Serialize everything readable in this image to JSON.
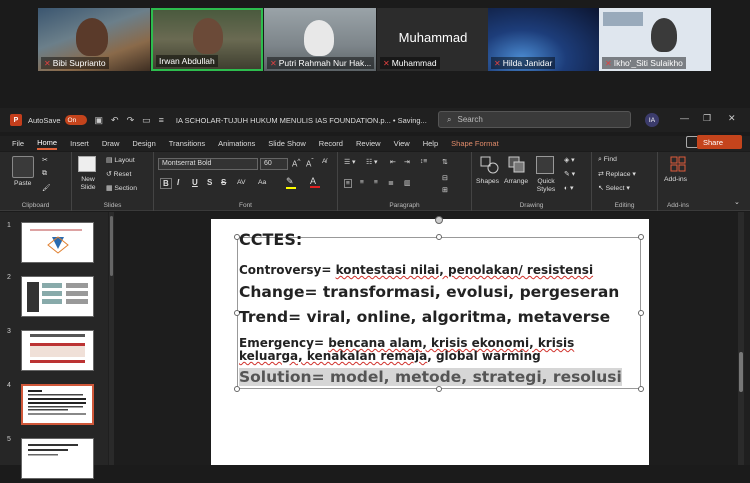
{
  "participants": [
    {
      "name": "Bibi Suprianto"
    },
    {
      "name": "Irwan Abdullah"
    },
    {
      "name": "Putri Rahmah Nur Hak..."
    },
    {
      "name": "Muhammad",
      "display": "Muhammad"
    },
    {
      "name": "Hilda Janidar"
    },
    {
      "name": "Ikho'_Siti Sulaikho"
    }
  ],
  "titlebar": {
    "autosave": "AutoSave",
    "toggle": "On",
    "doc_title": "IA SCHOLAR-TUJUH HUKUM MENULIS IAS FOUNDATION.p... • Saving...",
    "search_placeholder": "Search",
    "user_initials": "IA"
  },
  "menu": {
    "tabs": [
      "File",
      "Home",
      "Insert",
      "Draw",
      "Design",
      "Transitions",
      "Animations",
      "Slide Show",
      "Record",
      "Review",
      "View",
      "Help"
    ],
    "context_tab": "Shape Format",
    "share": "Share"
  },
  "ribbon": {
    "clipboard": {
      "paste": "Paste",
      "label": "Clipboard"
    },
    "slides": {
      "new_slide": "New Slide",
      "layout": "Layout",
      "reset": "Reset",
      "section": "Section",
      "label": "Slides"
    },
    "font": {
      "name": "Montserrat Bold",
      "size": "60",
      "label": "Font",
      "bold": "B",
      "italic": "I",
      "underline": "U",
      "strike": "S",
      "shadow": "ab",
      "spacing": "AV"
    },
    "paragraph": {
      "label": "Paragraph"
    },
    "drawing": {
      "shapes": "Shapes",
      "arrange": "Arrange",
      "quick_styles": "Quick Styles",
      "label": "Drawing"
    },
    "editing": {
      "find": "Find",
      "replace": "Replace",
      "select": "Select",
      "label": "Editing"
    },
    "addins": {
      "addins": "Add-ins",
      "label": "Add-ins"
    }
  },
  "thumbnails": [
    {
      "num": "1"
    },
    {
      "num": "2"
    },
    {
      "num": "3"
    },
    {
      "num": "4"
    },
    {
      "num": "5"
    }
  ],
  "slide": {
    "heading": "CCTES:",
    "controversy_label": "Controversy= ",
    "controversy_value": "kontestasi nilai, penolakan/ resistensi",
    "change": "Change= transformasi, evolusi, pergeseran",
    "trend": "Trend= viral, online, algoritma, metaverse",
    "emergency_line1_label": "Emergency= ",
    "emergency_line1_value": "bencana alam, krisis ekonomi, krisis",
    "emergency_line2_value": "keluarga, kenakalan remaja",
    "emergency_line2_tail": ", global warming",
    "solution": "Solution= model, metode, strategi, resolusi"
  }
}
